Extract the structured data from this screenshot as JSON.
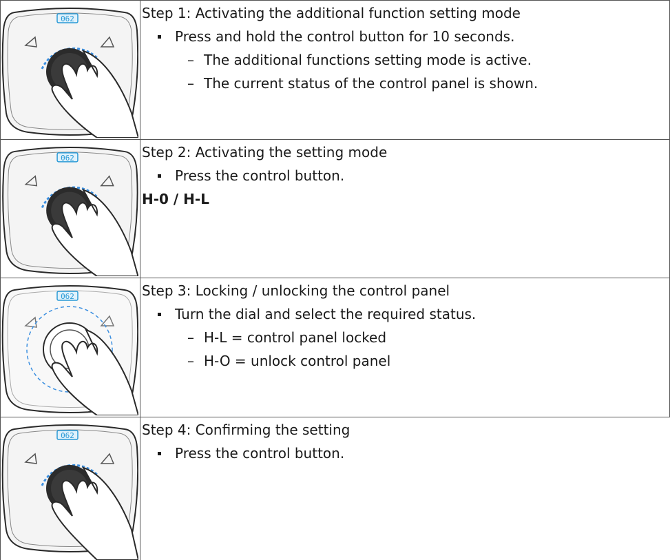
{
  "rows": [
    {
      "step": "Step 1: Activating the additional function setting mode",
      "bullet": "Press and hold the control button for 10 seconds.",
      "subs": [
        "The additional functions setting mode is active.",
        "The current status of the control panel is shown."
      ],
      "display": "062"
    },
    {
      "step": "Step 2: Activating the setting mode",
      "bullet": "Press the control button.",
      "note": "H-0 / H-L",
      "display": "062"
    },
    {
      "step": "Step 3: Locking / unlocking the control panel",
      "bullet": "Turn the dial and select the required status.",
      "subs": [
        "H-L = control panel locked",
        "H-O = unlock control panel"
      ],
      "display": "062"
    },
    {
      "step": "Step 4: Confirming the setting",
      "bullet": "Press the control button.",
      "display": "062"
    }
  ],
  "dash_glyph": "–",
  "colors": {
    "border": "#555555",
    "display": "#2a9ad6",
    "dial": "#2b2b2b",
    "ring": "#3b8fe0"
  },
  "icons": [
    "control-panel-illustration",
    "hand-icon"
  ]
}
